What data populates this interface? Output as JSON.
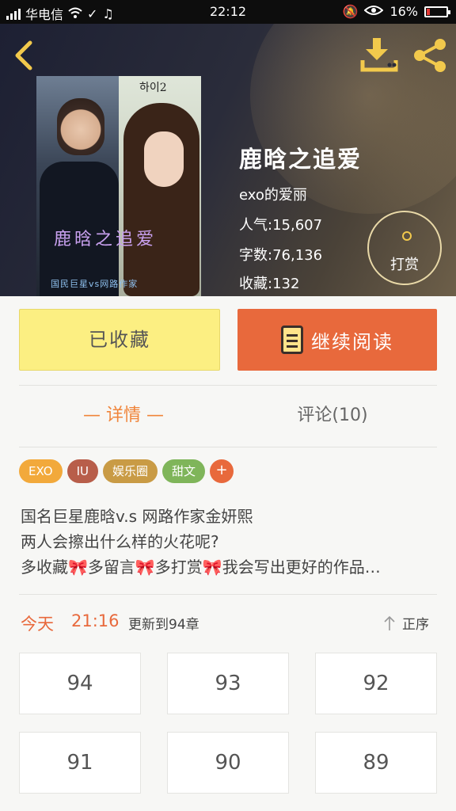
{
  "status_bar": {
    "carrier": "华电信",
    "time": "22:12",
    "battery_percent": "16%",
    "battery_level": 0.16,
    "battery_color": "#e53935"
  },
  "header": {
    "back_icon": "chevron-left-icon",
    "download_icon": "download-icon",
    "share_icon": "share-icon",
    "icon_color": "#f2c94c"
  },
  "cover": {
    "title_text": "鹿晗之追爱",
    "corner_text": "하이2",
    "subtitle_text": "国民巨星vs网路作家"
  },
  "book": {
    "title": "鹿晗之追爱",
    "author": "exo的爱丽",
    "popularity": "人气:15,607",
    "word_count": "字数:76,136",
    "favorites": "收藏:132"
  },
  "tip": {
    "label": "打赏"
  },
  "actions": {
    "favorited_label": "已收藏",
    "continue_label": "继续阅读",
    "favorited_color": "#fcef82",
    "continue_color": "#e8693c"
  },
  "tabs": {
    "details": "— 详情 —",
    "comments": "评论(10)"
  },
  "tags": [
    {
      "label": "EXO",
      "color": "#f2a93b"
    },
    {
      "label": "IU",
      "color": "#b85e4a"
    },
    {
      "label": "娱乐圈",
      "color": "#c99b45"
    },
    {
      "label": "甜文",
      "color": "#7fb55a"
    }
  ],
  "tag_add": "+",
  "description": [
    "国名巨星鹿晗v.s 网路作家金妍熙",
    "两人会擦出什么样的火花呢?",
    "多收藏🎀多留言🎀多打赏🎀我会写出更好的作品…"
  ],
  "update": {
    "day": "今天",
    "time": "21:16",
    "text": "更新到94章",
    "sort_label": "正序"
  },
  "chapters": [
    "94",
    "93",
    "92",
    "91",
    "90",
    "89"
  ]
}
